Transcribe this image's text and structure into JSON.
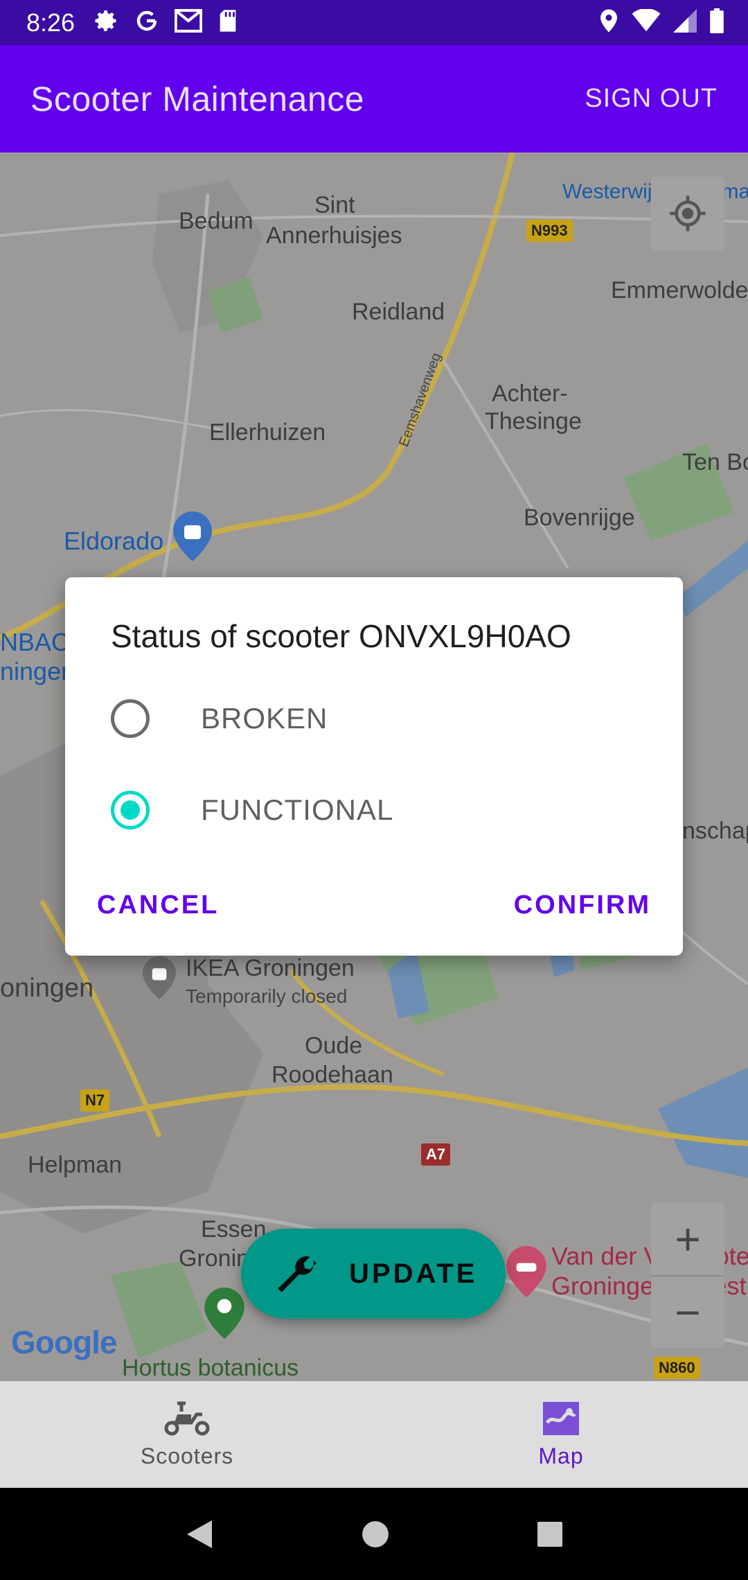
{
  "status_bar": {
    "time": "8:26",
    "left_icons": [
      "gear-icon",
      "google-icon",
      "gmail-icon",
      "sd-card-icon"
    ],
    "right_icons": [
      "location-icon",
      "wifi-icon",
      "signal-icon",
      "battery-icon"
    ]
  },
  "app_bar": {
    "title": "Scooter Maintenance",
    "sign_out_label": "SIGN OUT",
    "color": "#6200ee"
  },
  "map": {
    "labels": {
      "bedum": "Bedum",
      "sint": "Sint",
      "annerhuisjes": "Annerhuisjes",
      "westerwijtwerd": "Westerwijtwerdermaa",
      "emmerwolde": "Emmerwolde",
      "reidland": "Reidland",
      "achter": "Achter-",
      "thesinge": "Thesinge",
      "ellerhuizen": "Ellerhuizen",
      "ten_bo": "Ten Bo",
      "eldorado": "Eldorado",
      "bovenrijge": "Bovenrijge",
      "nbach": "NBACH",
      "ningen": "ningen",
      "schap": "nschap",
      "groningen": "oningen",
      "ikea": "IKEA Groningen",
      "temporarily_closed": "Temporarily closed",
      "oude": "Oude",
      "roodehaan": "Roodehaan",
      "helpman": "Helpman",
      "essen": "Essen",
      "gronin": "Gronin",
      "van_der_valk_1": "Van der Valk Hote",
      "van_der_valk_2": "Groningen - West",
      "hortus": "Hortus botanicus",
      "eemshavenweg": "Eemshavenweg",
      "google": "Google"
    },
    "road_signs": {
      "n993": "N993",
      "n7": "N7",
      "a7": "A7",
      "n860": "N860"
    },
    "zoom_in": "+",
    "zoom_out": "−"
  },
  "dialog": {
    "title": "Status of scooter ONVXL9H0AO",
    "options": [
      {
        "label": "BROKEN",
        "selected": false
      },
      {
        "label": "FUNCTIONAL",
        "selected": true
      }
    ],
    "cancel_label": "CANCEL",
    "confirm_label": "CONFIRM",
    "accent_color": "#03dac5"
  },
  "fab": {
    "label": "UPDATE",
    "icon": "wrench-icon",
    "color": "#019789"
  },
  "bottom_nav": {
    "items": [
      {
        "label": "Scooters",
        "icon": "scooter-icon",
        "active": false
      },
      {
        "label": "Map",
        "icon": "map-icon",
        "active": true
      }
    ]
  },
  "system_nav": [
    "back-icon",
    "home-icon",
    "recents-icon"
  ]
}
